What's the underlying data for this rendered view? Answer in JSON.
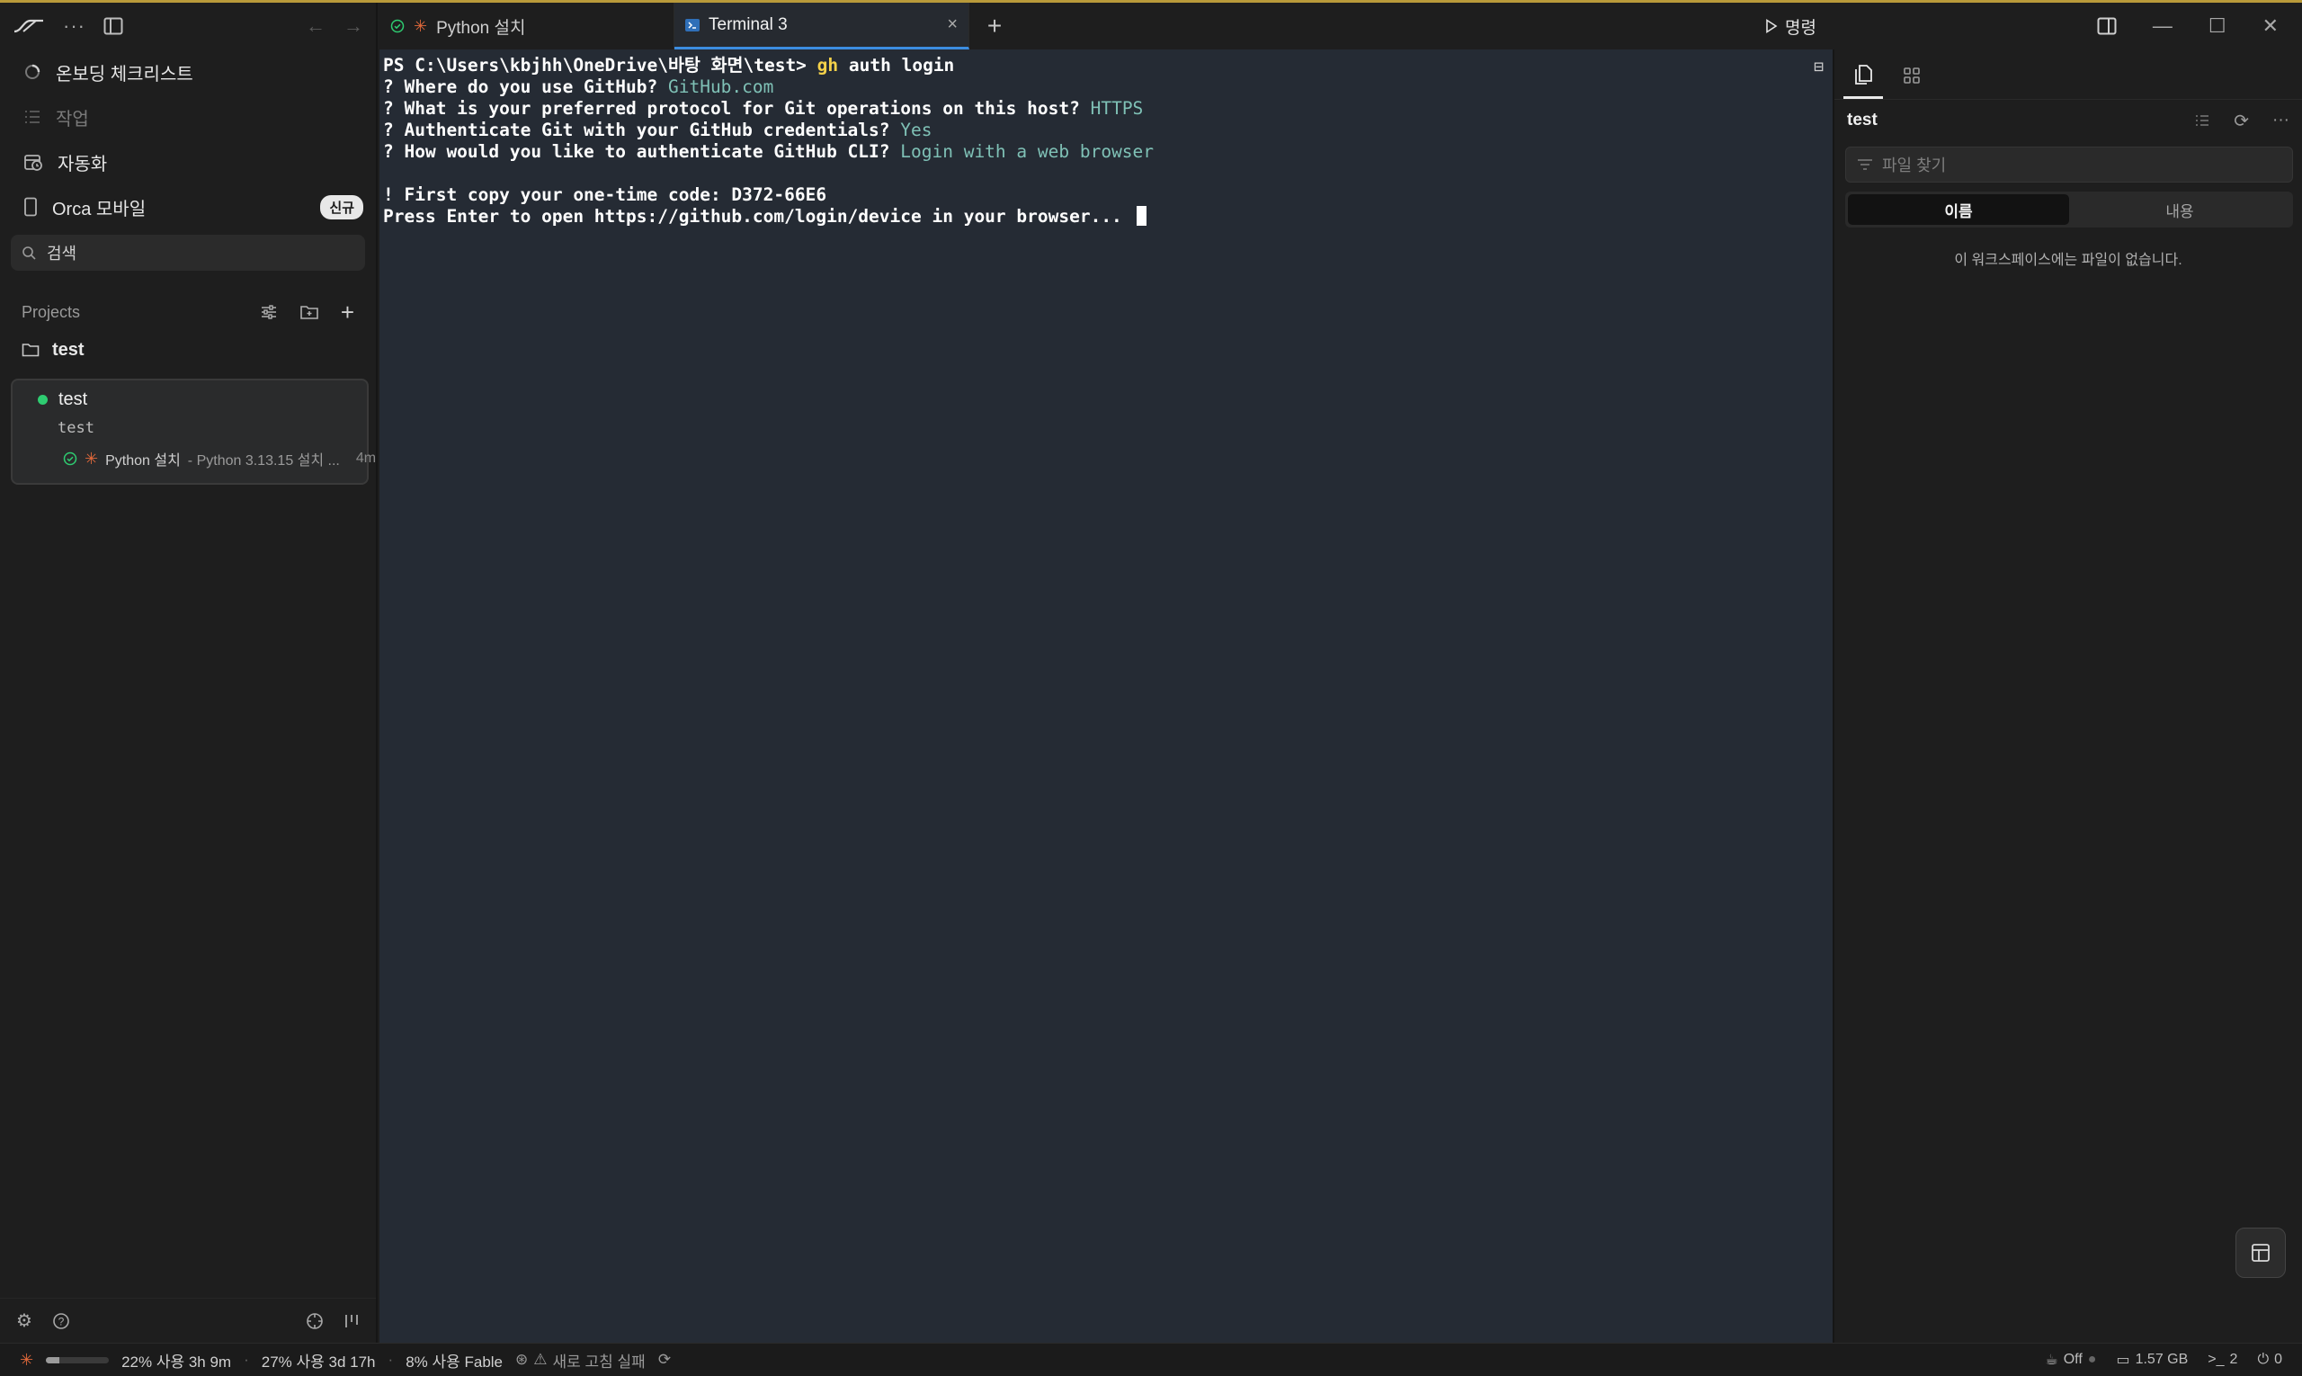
{
  "sidebar": {
    "menu": [
      {
        "label": "온보딩 체크리스트",
        "icon": "progress-circle-icon"
      },
      {
        "label": "작업",
        "icon": "list-icon"
      },
      {
        "label": "자동화",
        "icon": "calendar-clock-icon"
      },
      {
        "label": "Orca 모바일",
        "icon": "mobile-icon",
        "badge": "신규"
      }
    ],
    "search_placeholder": "검색",
    "projects_label": "Projects",
    "project_name": "test",
    "workspace": {
      "title": "test",
      "subtitle": "test",
      "session_name": "Python 설치",
      "session_detail": "- Python 3.13.15 설치 ...",
      "session_age": "4m"
    }
  },
  "tabs": {
    "items": [
      {
        "label": "Python 설치",
        "active": false
      },
      {
        "label": "Terminal 3",
        "active": true
      }
    ],
    "command_label": "명령"
  },
  "terminal": {
    "prompt": "PS C:\\Users\\kbjhh\\OneDrive\\바탕 화면\\test>",
    "command_gh": "gh",
    "command_args": " auth login",
    "lines": [
      {
        "q": "? Where do you use GitHub? ",
        "a": "GitHub.com"
      },
      {
        "q": "? What is your preferred protocol for Git operations on this host? ",
        "a": "HTTPS"
      },
      {
        "q": "? Authenticate Git with your GitHub credentials? ",
        "a": "Yes"
      },
      {
        "q": "? How would you like to authenticate GitHub CLI? ",
        "a": "Login with a web browser"
      }
    ],
    "code_line": "! First copy your one-time code: D372-66E6",
    "enter_line": "Press Enter to open https://github.com/login/device in your browser... "
  },
  "right_panel": {
    "title": "test",
    "file_search_placeholder": "파일 찾기",
    "seg_name": "이름",
    "seg_content": "내용",
    "empty_message": "이 워크스페이스에는 파일이 없습니다."
  },
  "status": {
    "usage_fill_fraction": 0.22,
    "usage1": "22% 사용 3h 9m",
    "usage2": "27% 사용 3d 17h",
    "usage3": "8% 사용 Fable",
    "refresh_failed": "새로 고침 실패",
    "off_label": "Off",
    "memory": "1.57 GB",
    "terminals": "2",
    "ports": "0"
  },
  "colors": {
    "accent_top": "#b99a3a",
    "active_tab_underline": "#3c8de0",
    "terminal_bg": "#252b34",
    "answer_cyan": "#7fc1b6",
    "command_yellow": "#f5d24a",
    "status_green": "#2ecc71",
    "claude_orange": "#e0683a"
  }
}
